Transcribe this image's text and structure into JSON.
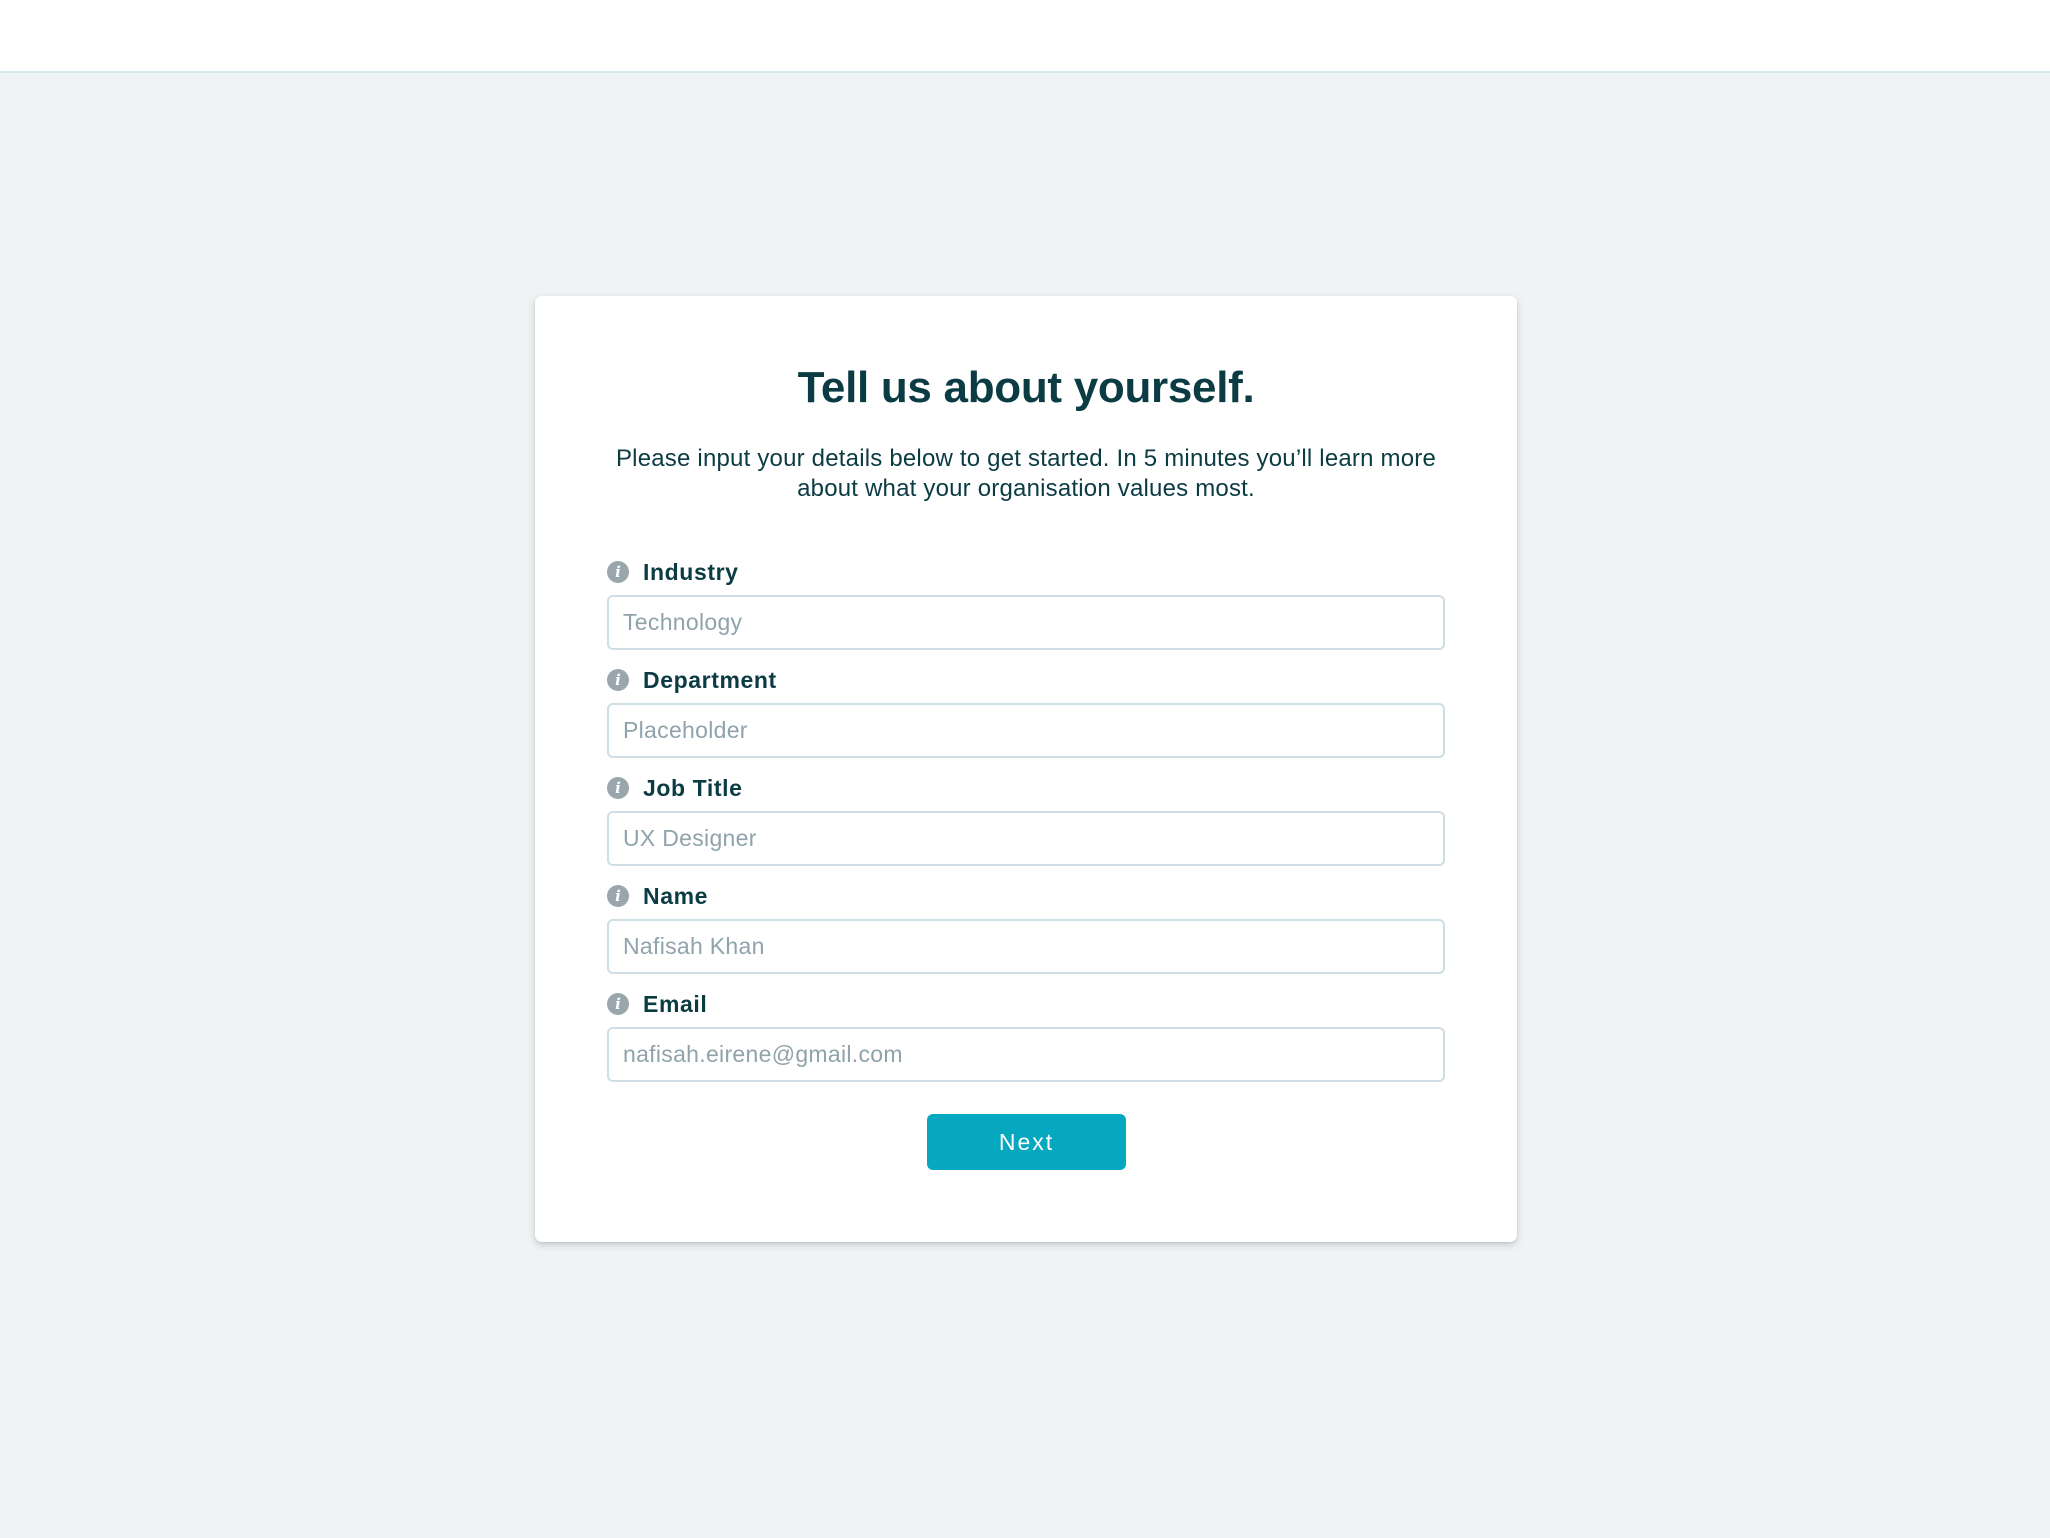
{
  "header": {},
  "form": {
    "title": "Tell us about yourself.",
    "subtitle": "Please input your details below to get started. In 5 minutes you’ll learn more about what your organisation values most.",
    "fields": [
      {
        "label": "Industry",
        "value": "",
        "placeholder": "Technology",
        "icon": "info-icon"
      },
      {
        "label": "Department",
        "value": "",
        "placeholder": "Placeholder",
        "icon": "info-icon"
      },
      {
        "label": "Job Title",
        "value": "",
        "placeholder": "UX Designer",
        "icon": "info-icon"
      },
      {
        "label": "Name",
        "value": "",
        "placeholder": "Nafisah Khan",
        "icon": "info-icon"
      },
      {
        "label": "Email",
        "value": "",
        "placeholder": "nafisah.eirene@gmail.com",
        "icon": "info-icon"
      }
    ],
    "next_label": "Next"
  },
  "colors": {
    "background": "#eff3f4",
    "text": "#0b3b43",
    "accent": "#06a8bf",
    "input_border": "#cfdde4",
    "icon": "#9aa6ad"
  }
}
